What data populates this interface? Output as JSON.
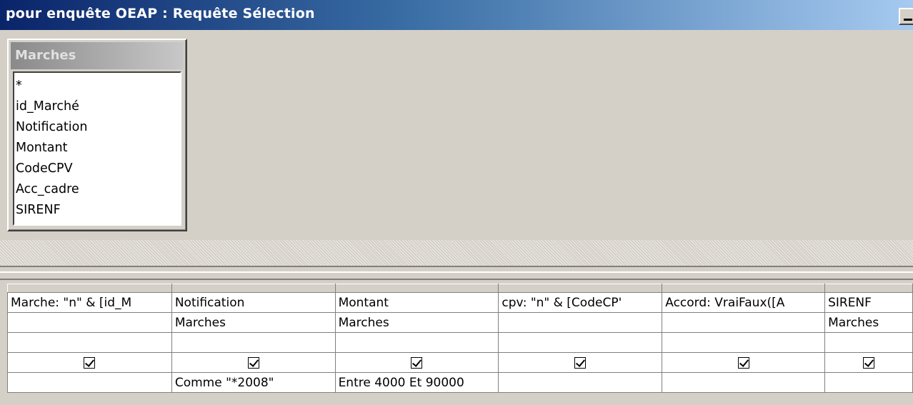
{
  "window": {
    "title": "pour enquête OEAP : Requête Sélection"
  },
  "field_list": {
    "title": "Marches",
    "items": [
      "*",
      "id_Marché",
      "Notification",
      "Montant",
      "CodeCPV",
      "Acc_cadre",
      "SIRENF"
    ]
  },
  "query_grid": {
    "columns": [
      {
        "field": "Marche: \"n\" & [id_M",
        "table": "",
        "sort": "",
        "show": true,
        "criteria": ""
      },
      {
        "field": "Notification",
        "table": "Marches",
        "sort": "",
        "show": true,
        "criteria": "Comme \"*2008\""
      },
      {
        "field": "Montant",
        "table": "Marches",
        "sort": "",
        "show": true,
        "criteria": "Entre 4000 Et 90000"
      },
      {
        "field": "cpv: \"n\" & [CodeCP'",
        "table": "",
        "sort": "",
        "show": true,
        "criteria": ""
      },
      {
        "field": "Accord: VraiFaux([A",
        "table": "",
        "sort": "",
        "show": true,
        "criteria": ""
      },
      {
        "field": "SIRENF",
        "table": "Marches",
        "sort": "",
        "show": true,
        "criteria": ""
      }
    ]
  }
}
